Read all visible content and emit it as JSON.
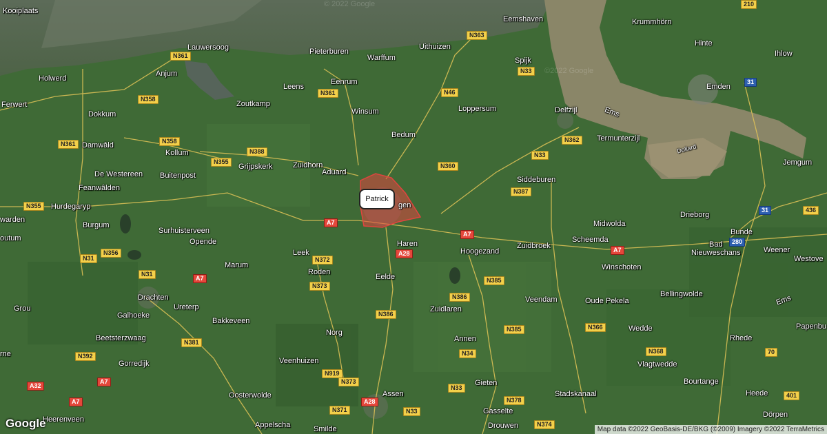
{
  "map": {
    "place_labels": [
      {
        "id": "kooiplaats",
        "text": "Kooiplaats"
      },
      {
        "id": "lauwersoog",
        "text": "Lauwersoog"
      },
      {
        "id": "anjum",
        "text": "Anjum"
      },
      {
        "id": "holwerd",
        "text": "Holwerd"
      },
      {
        "id": "ferwert",
        "text": "Ferwert"
      },
      {
        "id": "dokkum",
        "text": "Dokkum"
      },
      {
        "id": "damwald",
        "text": "Damwâld"
      },
      {
        "id": "kollum",
        "text": "Kollum"
      },
      {
        "id": "de-westereen",
        "text": "De Westereen"
      },
      {
        "id": "feanwalden",
        "text": "Feanwâlden"
      },
      {
        "id": "buitenpost",
        "text": "Buitenpost"
      },
      {
        "id": "hurdegaryp",
        "text": "Hurdegaryp"
      },
      {
        "id": "warden",
        "text": "warden"
      },
      {
        "id": "burgum",
        "text": "Burgum"
      },
      {
        "id": "outum",
        "text": "outum"
      },
      {
        "id": "surhuisterveen",
        "text": "Surhuisterveen"
      },
      {
        "id": "opende",
        "text": "Opende"
      },
      {
        "id": "marum",
        "text": "Marum"
      },
      {
        "id": "drachten",
        "text": "Drachten"
      },
      {
        "id": "ureterp",
        "text": "Ureterp"
      },
      {
        "id": "grou",
        "text": "Grou"
      },
      {
        "id": "galhoeke",
        "text": "Galhoeke"
      },
      {
        "id": "beetsterzwaag",
        "text": "Beetsterzwaag"
      },
      {
        "id": "gorredijk",
        "text": "Gorredijk"
      },
      {
        "id": "heerenveen",
        "text": "Heerenveen"
      },
      {
        "id": "rne",
        "text": "rne"
      },
      {
        "id": "zoutkamp",
        "text": "Zoutkamp"
      },
      {
        "id": "grijpskerk",
        "text": "Grijpskerk"
      },
      {
        "id": "zuidhorn",
        "text": "Zuidhorn"
      },
      {
        "id": "aduard",
        "text": "Aduard"
      },
      {
        "id": "leens",
        "text": "Leens"
      },
      {
        "id": "pieterburen",
        "text": "Pieterburen"
      },
      {
        "id": "warffum",
        "text": "Warffum"
      },
      {
        "id": "uithuizen",
        "text": "Uithuizen"
      },
      {
        "id": "eenrum",
        "text": "Eenrum"
      },
      {
        "id": "winsum",
        "text": "Winsum"
      },
      {
        "id": "bedum",
        "text": "Bedum"
      },
      {
        "id": "loppersum",
        "text": "Loppersum"
      },
      {
        "id": "eemshaven",
        "text": "Eemshaven"
      },
      {
        "id": "spijk",
        "text": "Spijk"
      },
      {
        "id": "delfzijl",
        "text": "Delfzijl"
      },
      {
        "id": "termunterzijl",
        "text": "Termunterzijl"
      },
      {
        "id": "siddeburen",
        "text": "Siddeburen"
      },
      {
        "id": "leek",
        "text": "Leek"
      },
      {
        "id": "roden",
        "text": "Roden"
      },
      {
        "id": "haren",
        "text": "Haren"
      },
      {
        "id": "hoogezand",
        "text": "Hoogezand"
      },
      {
        "id": "eelde",
        "text": "Eelde"
      },
      {
        "id": "zuidlaren",
        "text": "Zuidlaren"
      },
      {
        "id": "bakkeveen",
        "text": "Bakkeveen"
      },
      {
        "id": "norg",
        "text": "Norg"
      },
      {
        "id": "veenhuizen",
        "text": "Veenhuizen"
      },
      {
        "id": "oosterwolde",
        "text": "Oosterwolde"
      },
      {
        "id": "appelscha",
        "text": "Appelscha"
      },
      {
        "id": "smilde",
        "text": "Smilde"
      },
      {
        "id": "assen",
        "text": "Assen"
      },
      {
        "id": "annen",
        "text": "Annen"
      },
      {
        "id": "gieten",
        "text": "Gieten"
      },
      {
        "id": "gasselte",
        "text": "Gasselte"
      },
      {
        "id": "drouwen",
        "text": "Drouwen"
      },
      {
        "id": "veendam",
        "text": "Veendam"
      },
      {
        "id": "zuidbroek",
        "text": "Zuidbroek"
      },
      {
        "id": "midwolda",
        "text": "Midwolda"
      },
      {
        "id": "scheemda",
        "text": "Scheemda"
      },
      {
        "id": "winschoten",
        "text": "Winschoten"
      },
      {
        "id": "oude-pekela",
        "text": "Oude Pekela"
      },
      {
        "id": "bellingwolde",
        "text": "Bellingwolde"
      },
      {
        "id": "wedde",
        "text": "Wedde"
      },
      {
        "id": "vlagtwedde",
        "text": "Vlagtwedde"
      },
      {
        "id": "bourtange",
        "text": "Bourtange"
      },
      {
        "id": "stadskanaal",
        "text": "Stadskanaal"
      },
      {
        "id": "krummhorn",
        "text": "Krummhörn"
      },
      {
        "id": "hinte",
        "text": "Hinte"
      },
      {
        "id": "ihlow",
        "text": "Ihlow"
      },
      {
        "id": "emden",
        "text": "Emden"
      },
      {
        "id": "ems",
        "text": "Ems"
      },
      {
        "id": "dollard",
        "text": "Dollard"
      },
      {
        "id": "jemgum",
        "text": "Jemgum"
      },
      {
        "id": "drieborg",
        "text": "Drieborg"
      },
      {
        "id": "bunde",
        "text": "Bunde"
      },
      {
        "id": "bad-nieuweschans",
        "text": "Bad\nNieuweschans"
      },
      {
        "id": "weener",
        "text": "Weener"
      },
      {
        "id": "westove",
        "text": "Westove"
      },
      {
        "id": "ems2",
        "text": "Ems"
      },
      {
        "id": "papenbu",
        "text": "Papenbu"
      },
      {
        "id": "rhede",
        "text": "Rhede"
      },
      {
        "id": "heede",
        "text": "Heede"
      },
      {
        "id": "dorpen",
        "text": "Dörpen"
      },
      {
        "id": "groningen-partial",
        "text": "gen"
      }
    ],
    "road_shields": [
      {
        "id": "n361a",
        "text": "N361",
        "style": "yellow"
      },
      {
        "id": "n358a",
        "text": "N358",
        "style": "yellow"
      },
      {
        "id": "n358b",
        "text": "N358",
        "style": "yellow"
      },
      {
        "id": "n361b",
        "text": "N361",
        "style": "yellow"
      },
      {
        "id": "n355a",
        "text": "N355",
        "style": "yellow"
      },
      {
        "id": "n355b",
        "text": "N355",
        "style": "yellow"
      },
      {
        "id": "n388",
        "text": "N388",
        "style": "yellow"
      },
      {
        "id": "n361c",
        "text": "N361",
        "style": "yellow"
      },
      {
        "id": "n363",
        "text": "N363",
        "style": "yellow"
      },
      {
        "id": "n33a",
        "text": "N33",
        "style": "yellow"
      },
      {
        "id": "n46",
        "text": "N46",
        "style": "yellow"
      },
      {
        "id": "n360",
        "text": "N360",
        "style": "yellow"
      },
      {
        "id": "n33b",
        "text": "N33",
        "style": "yellow"
      },
      {
        "id": "n362",
        "text": "N362",
        "style": "yellow"
      },
      {
        "id": "n387",
        "text": "N387",
        "style": "yellow"
      },
      {
        "id": "a7a",
        "text": "A7",
        "style": "red"
      },
      {
        "id": "a7b",
        "text": "A7",
        "style": "red"
      },
      {
        "id": "a7c",
        "text": "A7",
        "style": "red"
      },
      {
        "id": "a7d",
        "text": "A7",
        "style": "red"
      },
      {
        "id": "a7e",
        "text": "A7",
        "style": "red"
      },
      {
        "id": "a7f",
        "text": "A7",
        "style": "red"
      },
      {
        "id": "a28a",
        "text": "A28",
        "style": "red"
      },
      {
        "id": "a28b",
        "text": "A28",
        "style": "red"
      },
      {
        "id": "a32",
        "text": "A32",
        "style": "red"
      },
      {
        "id": "n356",
        "text": "N356",
        "style": "yellow"
      },
      {
        "id": "n31a",
        "text": "N31",
        "style": "yellow"
      },
      {
        "id": "n31b",
        "text": "N31",
        "style": "yellow"
      },
      {
        "id": "n372",
        "text": "N372",
        "style": "yellow"
      },
      {
        "id": "n373a",
        "text": "N373",
        "style": "yellow"
      },
      {
        "id": "n373b",
        "text": "N373",
        "style": "yellow"
      },
      {
        "id": "n381",
        "text": "N381",
        "style": "yellow"
      },
      {
        "id": "n392",
        "text": "N392",
        "style": "yellow"
      },
      {
        "id": "n386a",
        "text": "N386",
        "style": "yellow"
      },
      {
        "id": "n386b",
        "text": "N386",
        "style": "yellow"
      },
      {
        "id": "n385a",
        "text": "N385",
        "style": "yellow"
      },
      {
        "id": "n385b",
        "text": "N385",
        "style": "yellow"
      },
      {
        "id": "n34",
        "text": "N34",
        "style": "yellow"
      },
      {
        "id": "n33c",
        "text": "N33",
        "style": "yellow"
      },
      {
        "id": "n33d",
        "text": "N33",
        "style": "yellow"
      },
      {
        "id": "n919",
        "text": "N919",
        "style": "yellow"
      },
      {
        "id": "n371",
        "text": "N371",
        "style": "yellow"
      },
      {
        "id": "n378",
        "text": "N378",
        "style": "yellow"
      },
      {
        "id": "n374",
        "text": "N374",
        "style": "yellow"
      },
      {
        "id": "n366",
        "text": "N366",
        "style": "yellow"
      },
      {
        "id": "n368",
        "text": "N368",
        "style": "yellow"
      },
      {
        "id": "s210",
        "text": "210",
        "style": "yellow"
      },
      {
        "id": "s31a",
        "text": "31",
        "style": "blue"
      },
      {
        "id": "s31b",
        "text": "31",
        "style": "blue"
      },
      {
        "id": "s280",
        "text": "280",
        "style": "blue"
      },
      {
        "id": "s436",
        "text": "436",
        "style": "yellow"
      },
      {
        "id": "s70",
        "text": "70",
        "style": "yellow"
      },
      {
        "id": "s401",
        "text": "401",
        "style": "yellow"
      }
    ],
    "marker_popup": {
      "text": "Patrick"
    },
    "watermarks": [
      "© 2022 Google",
      "©2022 Google"
    ],
    "logo": "Google",
    "attribution": "Map data ©2022 GeoBasis-DE/BKG (©2009) Imagery ©2022 TerraMetrics",
    "colors": {
      "land": "#3e6a35",
      "water": "#8b8a6b",
      "region_fill": "#e0453f",
      "region_stroke": "#e0453f"
    }
  }
}
